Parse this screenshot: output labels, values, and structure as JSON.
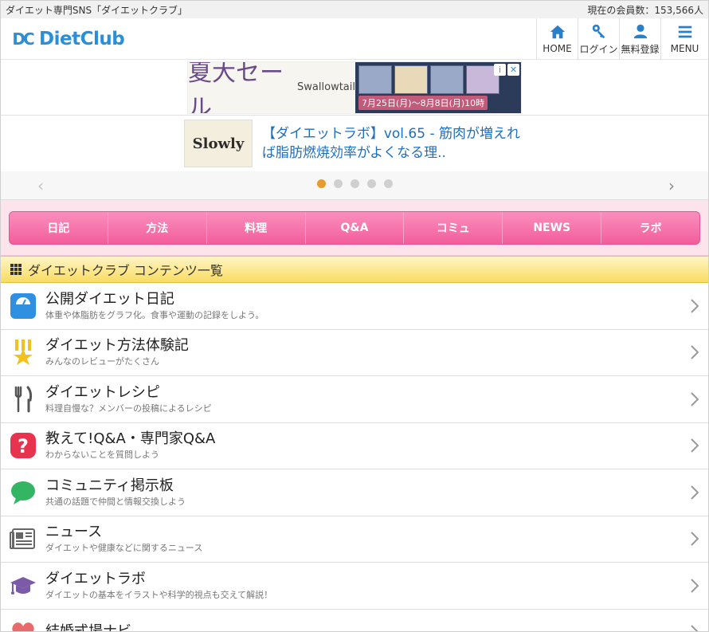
{
  "topbar": {
    "site_tagline": "ダイエット専門SNS「ダイエットクラブ」",
    "member_count": "現在の会員数：153,566人"
  },
  "header": {
    "logo_mark": "DC",
    "logo_text": "DietClub",
    "nav": [
      {
        "label": "HOME",
        "icon": "home-icon"
      },
      {
        "label": "ログイン",
        "icon": "key-icon"
      },
      {
        "label": "無料登録",
        "icon": "user-icon"
      },
      {
        "label": "MENU",
        "icon": "menu-icon"
      }
    ]
  },
  "ad": {
    "headline": "夏大セール",
    "brand": "Swallowtail",
    "date_text": "7月25日(月)〜8月8日(月)10時",
    "close_labels": [
      "i",
      "✕"
    ]
  },
  "carousel": {
    "thumb_text": "Slowly",
    "title": "【ダイエットラボ】vol.65 - 筋肉が増えれば脂肪燃焼効率がよくなる理..",
    "dot_count": 5,
    "active_dot": 0
  },
  "tabs": [
    "日記",
    "方法",
    "料理",
    "Q&A",
    "コミュ",
    "NEWS",
    "ラボ"
  ],
  "section": {
    "title": "ダイエットクラブ コンテンツ一覧"
  },
  "items": [
    {
      "title": "公開ダイエット日記",
      "desc": "体重や体脂肪をグラフ化。食事や運動の記録をしよう。",
      "icon": "scale-icon"
    },
    {
      "title": "ダイエット方法体験記",
      "desc": "みんなのレビューがたくさん",
      "icon": "star-ribbon-icon"
    },
    {
      "title": "ダイエットレシピ",
      "desc": "料理自慢な？メンバーの投稿によるレシピ",
      "icon": "fork-knife-icon"
    },
    {
      "title": "教えて!Q&A・専門家Q&A",
      "desc": "わからないことを質問しよう",
      "icon": "question-icon"
    },
    {
      "title": "コミュニティ掲示板",
      "desc": "共通の話題で仲間と情報交換しよう",
      "icon": "speech-bubble-icon"
    },
    {
      "title": "ニュース",
      "desc": "ダイエットや健康などに関するニュース",
      "icon": "newspaper-icon"
    },
    {
      "title": "ダイエットラボ",
      "desc": "ダイエットの基本をイラストや科学的視点も交えて解説！",
      "icon": "graduation-cap-icon"
    },
    {
      "title": "結婚式場ナビ",
      "desc": "",
      "icon": "heart-icon"
    }
  ],
  "colors": {
    "brand_blue": "#2a8fd6",
    "brand_orange": "#f39a1e",
    "tab_pink": "#f25d9c",
    "section_yellow": "#f9dc62"
  }
}
